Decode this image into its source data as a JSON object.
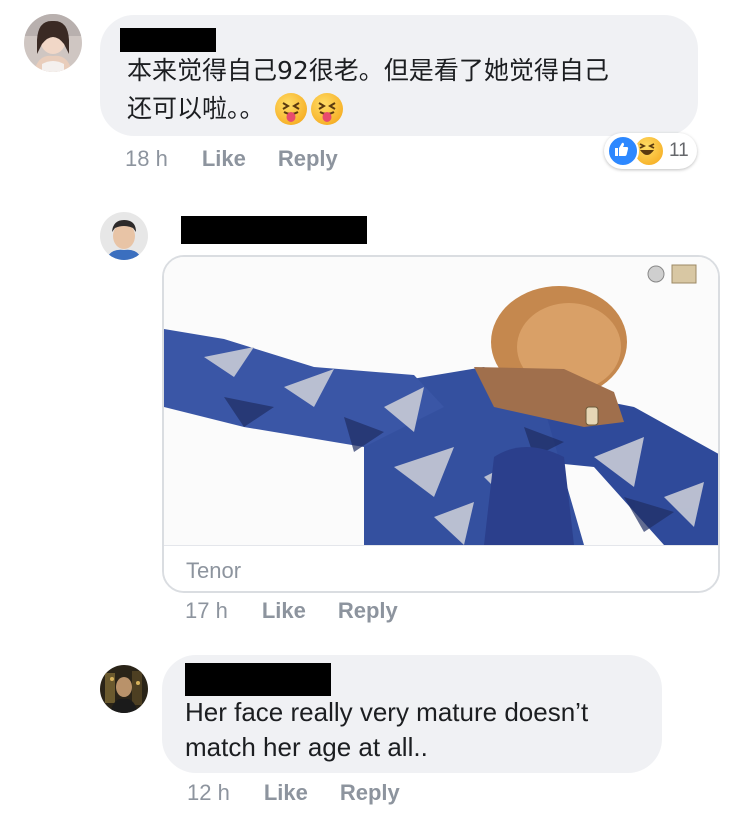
{
  "comments": [
    {
      "text_line1": "本来觉得自己92很老。但是看了她觉得自己",
      "text_line2": "还可以啦。。",
      "emoji_icons": [
        "squinting-tongue-emoji",
        "squinting-tongue-emoji"
      ],
      "timestamp": "18 h",
      "like_label": "Like",
      "reply_label": "Reply",
      "reactions": {
        "icons": [
          "like-reaction",
          "haha-reaction"
        ],
        "count": "11"
      }
    },
    {
      "gif_source": "Tenor",
      "timestamp": "17 h",
      "like_label": "Like",
      "reply_label": "Reply"
    },
    {
      "text_line1": "Her face really very mature doesn’t",
      "text_line2": "match her age at all..",
      "timestamp": "12 h",
      "like_label": "Like",
      "reply_label": "Reply"
    }
  ],
  "colors": {
    "bubble": "#f0f1f4",
    "meta_text": "#8d949e",
    "like_blue": "#2d88ff",
    "redaction": "#000000"
  }
}
